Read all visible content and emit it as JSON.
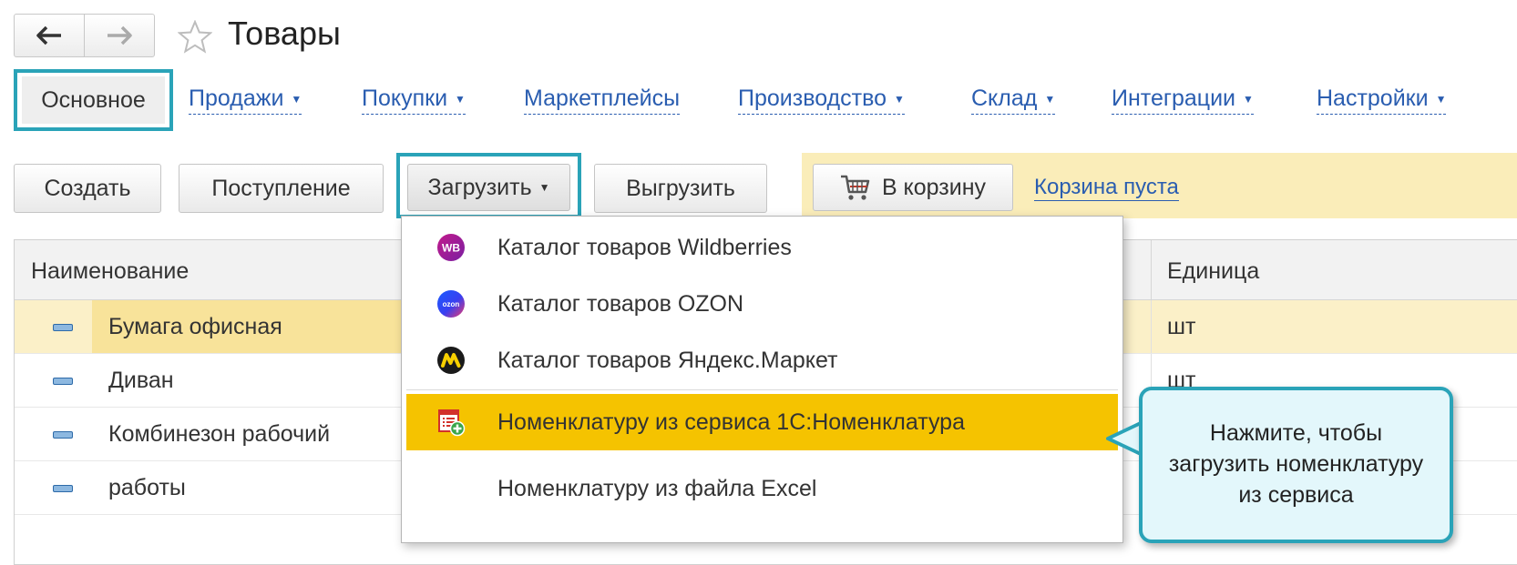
{
  "window": {
    "title": "Товары"
  },
  "tabs": {
    "main": "Основное",
    "sales": "Продажи",
    "purchases": "Покупки",
    "marketplaces": "Маркетплейсы",
    "production": "Производство",
    "warehouse": "Склад",
    "integrations": "Интеграции",
    "settings": "Настройки"
  },
  "toolbar": {
    "create": "Создать",
    "receipt": "Поступление",
    "load": "Загрузить",
    "unload": "Выгрузить",
    "to_cart": "В корзину",
    "cart_status": "Корзина пуста"
  },
  "table": {
    "columns": {
      "name": "Наименование",
      "unit": "Единица"
    },
    "rows": [
      {
        "name": "Бумага офисная",
        "unit": "шт"
      },
      {
        "name": "Диван",
        "unit": "шт"
      },
      {
        "name": "Комбинезон рабочий",
        "unit": ""
      },
      {
        "name": "работы",
        "unit": ""
      }
    ]
  },
  "menu": {
    "items": [
      {
        "label": "Каталог товаров Wildberries",
        "icon": "wildberries-icon"
      },
      {
        "label": "Каталог товаров OZON",
        "icon": "ozon-icon"
      },
      {
        "label": "Каталог товаров Яндекс.Маркет",
        "icon": "yandex-market-icon"
      },
      {
        "label": "Номенклатуру из сервиса 1С:Номенклатура",
        "icon": "nomenclature-add-icon"
      },
      {
        "label": "Номенклатуру из файла Excel",
        "icon": ""
      }
    ]
  },
  "callout": {
    "text": "Нажмите, чтобы загрузить номенклатуру из сервиса"
  },
  "colors": {
    "accent": "#2aa3b8",
    "link": "#2a5db0",
    "highlight": "#f5c300",
    "selected_row": "#fbf0c8",
    "cart_band": "#faedb9"
  }
}
